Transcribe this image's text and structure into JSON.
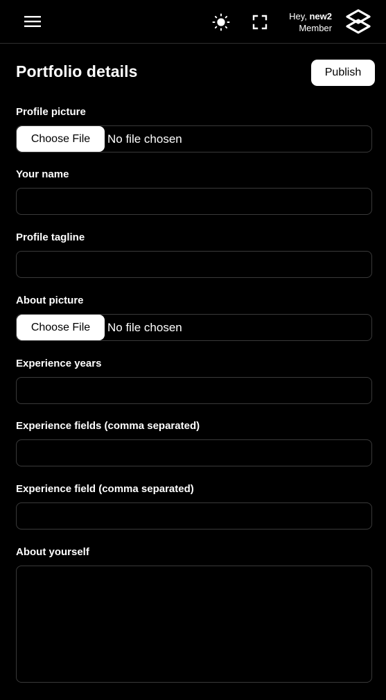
{
  "header": {
    "menu_icon": "hamburger-menu-icon",
    "theme_icon": "sun-icon",
    "fullscreen_icon": "fullscreen-icon",
    "greeting_prefix": "Hey,",
    "username": "new2",
    "role": "Member",
    "logo_icon": "brand-logo"
  },
  "page": {
    "title": "Portfolio details",
    "publish_label": "Publish"
  },
  "form": {
    "profile_picture": {
      "label": "Profile picture",
      "button": "Choose File",
      "status": "No file chosen"
    },
    "your_name": {
      "label": "Your name",
      "value": ""
    },
    "profile_tagline": {
      "label": "Profile tagline",
      "value": ""
    },
    "about_picture": {
      "label": "About picture",
      "button": "Choose File",
      "status": "No file chosen"
    },
    "experience_years": {
      "label": "Experience years",
      "value": ""
    },
    "experience_fields": {
      "label": "Experience fields (comma separated)",
      "value": ""
    },
    "experience_field": {
      "label": "Experience field (comma separated)",
      "value": ""
    },
    "about_yourself": {
      "label": "About yourself",
      "value": ""
    }
  },
  "colors": {
    "background": "#000000",
    "text": "#ffffff",
    "border": "#3a3a3a",
    "button_bg": "#ffffff"
  }
}
